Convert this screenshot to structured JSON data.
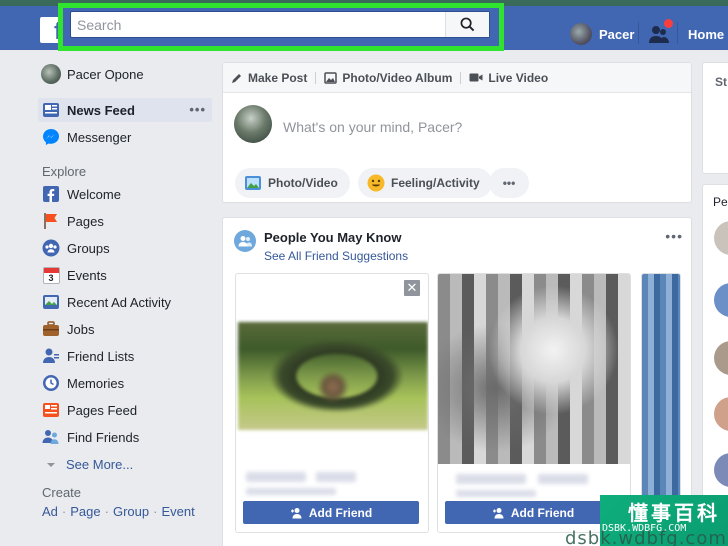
{
  "header": {
    "logo_letter": "f",
    "search_placeholder": "Search",
    "profile_name": "Pacer",
    "home_label": "Home"
  },
  "sidebar": {
    "profile_name": "Pacer Opone",
    "items": [
      {
        "label": "News Feed",
        "icon": "news-feed-icon"
      },
      {
        "label": "Messenger",
        "icon": "messenger-icon"
      }
    ],
    "explore_heading": "Explore",
    "explore": [
      {
        "label": "Welcome",
        "icon": "facebook-icon"
      },
      {
        "label": "Pages",
        "icon": "flag-icon"
      },
      {
        "label": "Groups",
        "icon": "groups-icon"
      },
      {
        "label": "Events",
        "icon": "calendar-icon"
      },
      {
        "label": "Recent Ad Activity",
        "icon": "ad-activity-icon"
      },
      {
        "label": "Jobs",
        "icon": "briefcase-icon"
      },
      {
        "label": "Friend Lists",
        "icon": "friend-lists-icon"
      },
      {
        "label": "Memories",
        "icon": "memories-clock-icon"
      },
      {
        "label": "Pages Feed",
        "icon": "pages-feed-icon"
      },
      {
        "label": "Find Friends",
        "icon": "find-friends-icon"
      }
    ],
    "see_more": "See More...",
    "create_heading": "Create",
    "create_links": [
      "Ad",
      "Page",
      "Group",
      "Event"
    ],
    "events_day": "3",
    "more_glyph": "•••"
  },
  "composer": {
    "tabs": [
      "Make Post",
      "Photo/Video Album",
      "Live Video"
    ],
    "placeholder": "What's on your mind, Pacer?",
    "buttons": [
      "Photo/Video",
      "Feeling/Activity"
    ],
    "more_glyph": "•••"
  },
  "pymk": {
    "title": "People You May Know",
    "subtitle": "See All Friend Suggestions",
    "add_friend": "Add Friend",
    "close_glyph": "✕",
    "more_glyph": "•••"
  },
  "right": {
    "box1_heading": "St",
    "box2_heading": "Pe"
  },
  "watermark": {
    "big": "懂事百科",
    "small": "DSBK.WDBFG.COM",
    "bottom": "dsbk.wdbfg.com"
  },
  "colors": {
    "brand_blue": "#4267b2",
    "highlight_green": "#2fe32f",
    "background": "#e9ebee",
    "link_blue": "#365899"
  }
}
